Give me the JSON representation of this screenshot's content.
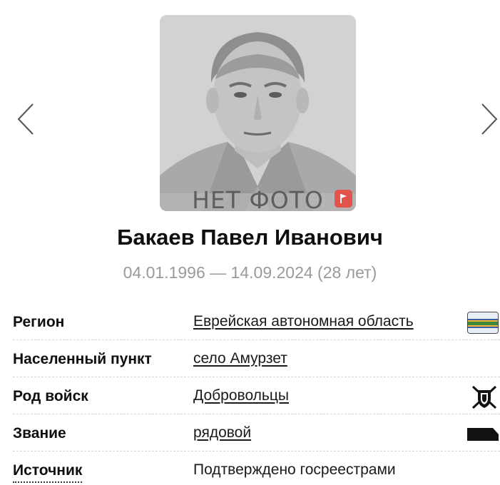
{
  "photo": {
    "placeholder_text": "НЕТ ФОТО",
    "badge_icon": "flag-icon",
    "badge_color": "#e2544b"
  },
  "person": {
    "name": "Бакаев Павел Иванович",
    "dates": "04.01.1996 — 14.09.2024 (28 лет)"
  },
  "navigation": {
    "prev_icon": "chevron-left-icon",
    "next_icon": "chevron-right-icon"
  },
  "details": {
    "region": {
      "label": "Регион",
      "value": "Еврейская автономная область",
      "icon": "region-flag-icon"
    },
    "settlement": {
      "label": "Населенный пункт",
      "value": "село Амурзет"
    },
    "troops": {
      "label": "Род войск",
      "value": "Добровольцы",
      "icon": "volunteers-emblem-icon"
    },
    "rank": {
      "label": "Звание",
      "value": "рядовой",
      "icon": "shoulder-strap-icon"
    },
    "source": {
      "label": "Источник",
      "value": "Подтверждено госреестрами"
    }
  },
  "colors": {
    "flag_stripes": [
      "#e8eef6",
      "#3b5fa8",
      "#f0b43a",
      "#3c8a3c",
      "#f0b43a",
      "#3b5fa8",
      "#e8eef6"
    ],
    "dates_text": "#9a9a9a"
  }
}
